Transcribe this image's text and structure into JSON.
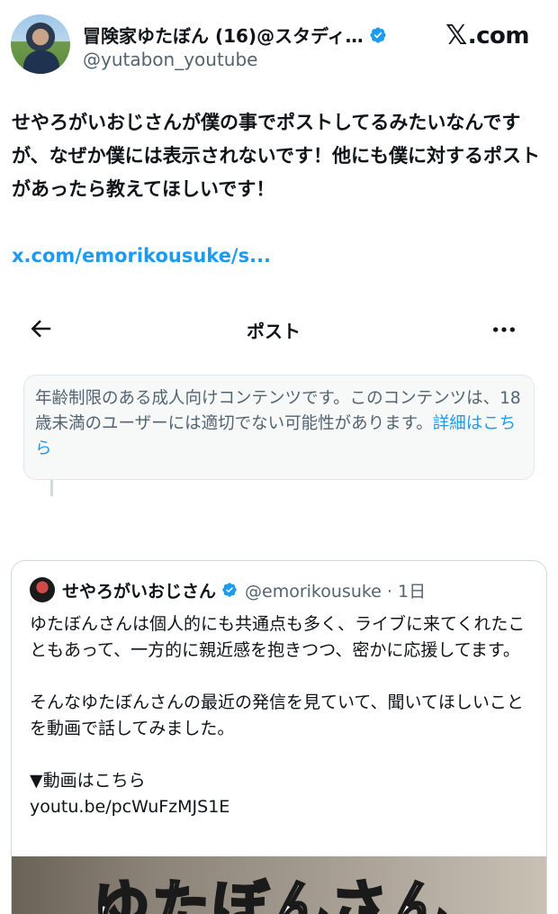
{
  "author": {
    "display_name": "冒険家ゆたぼん (16)@スタディ…",
    "handle": "@yutabon_youtube",
    "verified": true
  },
  "brand": {
    "logo_text": ".com",
    "logo_mark": "𝕏"
  },
  "tweet": {
    "text": "せやろがいおじさんが僕の事でポストしてるみたいなんですが、なぜか僕には表示されないです！他にも僕に対するポストがあったら教えてほしいです！",
    "link": "x.com/emorikousuke/s..."
  },
  "nav": {
    "title": "ポスト",
    "back_icon": "arrow-left-icon",
    "more_icon": "more-icon"
  },
  "warning": {
    "text": "年齢制限のある成人向けコンテンツです。このコンテンツは、18歳未満のユーザーには適切でない可能性があります。",
    "more_link": "詳細はこちら"
  },
  "quote": {
    "display_name": "せやろがいおじさん",
    "handle_time": "@emorikousuke · 1日",
    "lines": [
      "ゆたぼんさんは個人的にも共通点も多く、ライブに来てくれたこともあって、一方的に親近感を抱きつつ、密かに応援してます。",
      "そんなゆたぼんさんの最近の発信を見ていて、聞いてほしいことを動画で話してみました。",
      "▼動画はこちら"
    ],
    "link": "youtu.be/pcWuFzMJS1E",
    "media_caption": "ゆたぼんさん"
  },
  "colors": {
    "link": "#1d9bf0",
    "verified": "#1d9bf0",
    "muted": "#536471"
  }
}
